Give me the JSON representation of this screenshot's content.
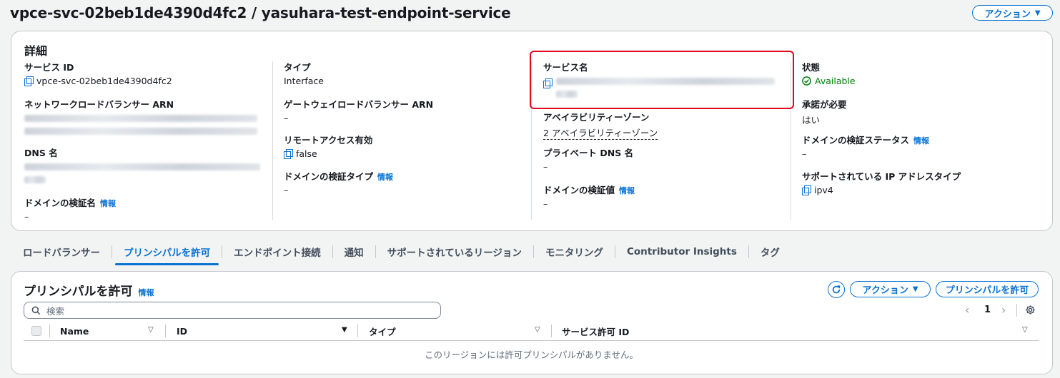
{
  "header": {
    "title": "vpce-svc-02beb1de4390d4fc2 / yasuhara-test-endpoint-service",
    "actions_label": "アクション"
  },
  "details": {
    "title": "詳細",
    "service_id": {
      "label": "サービス ID",
      "value": "vpce-svc-02beb1de4390d4fc2"
    },
    "nlb_arn": {
      "label": "ネットワークロードバランサー ARN"
    },
    "dns_name": {
      "label": "DNS 名"
    },
    "domain_name": {
      "label": "ドメインの検証名",
      "info": "情報",
      "value": "–"
    },
    "type": {
      "label": "タイプ",
      "value": "Interface"
    },
    "gwlb_arn": {
      "label": "ゲートウェイロードバランサー ARN",
      "value": "–"
    },
    "remote_access": {
      "label": "リモートアクセス有効",
      "value": "false"
    },
    "domain_type": {
      "label": "ドメインの検証タイプ",
      "info": "情報",
      "value": "–"
    },
    "service_name": {
      "label": "サービス名"
    },
    "az": {
      "label": "アベイラビリティーゾーン",
      "value": "2 アベイラビリティーゾーン"
    },
    "private_dns": {
      "label": "プライベート DNS 名",
      "value": "–"
    },
    "domain_value": {
      "label": "ドメインの検証値",
      "info": "情報",
      "value": "–"
    },
    "state": {
      "label": "状態",
      "value": "Available"
    },
    "acceptance": {
      "label": "承諾が必要",
      "value": "はい"
    },
    "domain_status": {
      "label": "ドメインの検証ステータス",
      "info": "情報",
      "value": "–"
    },
    "ip_type": {
      "label": "サポートされている IP アドレスタイプ",
      "value": "ipv4"
    }
  },
  "tabs": [
    {
      "label": "ロードバランサー"
    },
    {
      "label": "プリンシパルを許可"
    },
    {
      "label": "エンドポイント接続"
    },
    {
      "label": "通知"
    },
    {
      "label": "サポートされているリージョン"
    },
    {
      "label": "モニタリング"
    },
    {
      "label": "Contributor Insights"
    },
    {
      "label": "タグ"
    }
  ],
  "principals": {
    "title": "プリンシパルを許可",
    "info": "情報",
    "actions_label": "アクション",
    "allow_label": "プリンシパルを許可",
    "search_placeholder": "検索",
    "page": "1",
    "columns": [
      "Name",
      "ID",
      "タイプ",
      "サービス許可 ID"
    ],
    "empty_text": "このリージョンには許可プリンシパルがありません。"
  },
  "colors": {
    "accent": "#0972d3",
    "success": "#037f0c",
    "highlight": "#e0081a"
  },
  "icons": [
    "copy-icon",
    "check-circle-icon",
    "search-icon",
    "refresh-icon",
    "settings-icon",
    "chevron-left-icon",
    "chevron-right-icon",
    "sort-icon"
  ]
}
